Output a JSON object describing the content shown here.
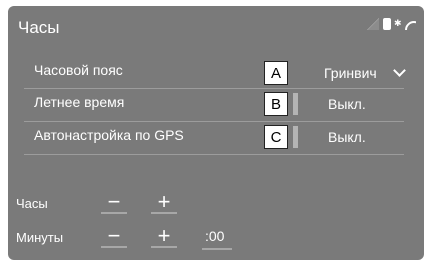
{
  "header": {
    "title": "Часы",
    "status_icons": [
      "no-signal-icon",
      "phone-icon",
      "bluetooth-icon",
      "wifi-icon"
    ]
  },
  "settings": [
    {
      "label": "Часовой пояс",
      "callout": "A",
      "value": "Гринвич",
      "has_dropdown": true
    },
    {
      "label": "Летнее время",
      "callout": "B",
      "value": "Выкл.",
      "has_dropdown": false
    },
    {
      "label": "Автонастройка по GPS",
      "callout": "C",
      "value": "Выкл.",
      "has_dropdown": false
    }
  ],
  "manual": {
    "hours_label": "Часы",
    "minutes_label": "Минуты",
    "minus_symbol": "−",
    "plus_symbol": "+",
    "zero_seconds_label": ":00"
  },
  "colors": {
    "panel_bg": "#7a7a7a",
    "text": "#ffffff",
    "divider": "#9c9c9c"
  }
}
